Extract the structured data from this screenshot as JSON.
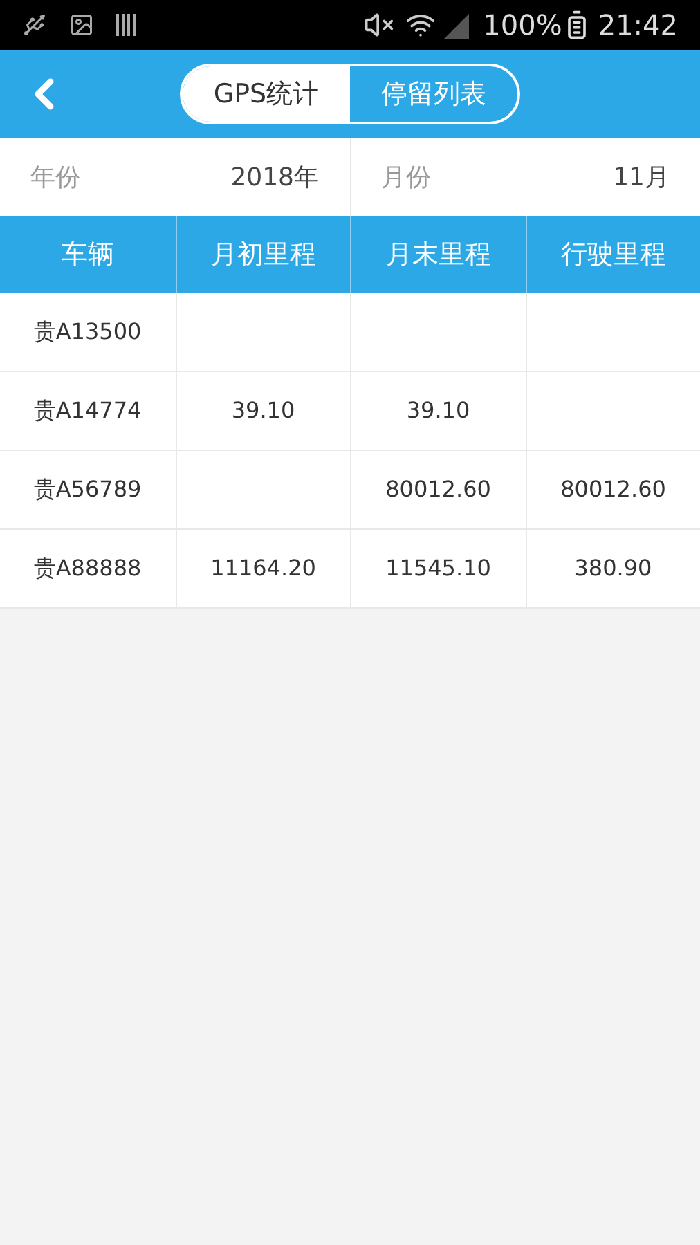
{
  "status_bar": {
    "battery": "100%",
    "time": "21:42"
  },
  "tabs": [
    {
      "label": "GPS统计",
      "selected": true
    },
    {
      "label": "停留列表",
      "selected": false
    }
  ],
  "filters": [
    {
      "label": "年份",
      "value": "2018年"
    },
    {
      "label": "月份",
      "value": "11月"
    }
  ],
  "table": {
    "columns": [
      "车辆",
      "月初里程",
      "月末里程",
      "行驶里程"
    ],
    "rows": [
      {
        "vehicle": "贵A13500"
      },
      {
        "vehicle": "贵A14774",
        "start": "39.10",
        "end": "39.10"
      },
      {
        "vehicle": "贵A56789",
        "end": "80012.60",
        "driven": "80012.60"
      },
      {
        "vehicle": "贵A88888",
        "start": "11164.20",
        "end": "11545.10",
        "driven": "380.90"
      }
    ]
  }
}
